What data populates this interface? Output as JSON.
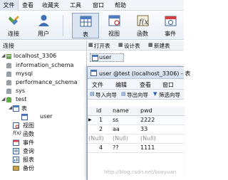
{
  "menubar": [
    "文件",
    "查看",
    "收藏夹",
    "工具",
    "窗口",
    "帮助"
  ],
  "toolbar": {
    "connect": "连接",
    "user": "用户",
    "table": "表",
    "view": "视图",
    "function": "函数",
    "event": "事件"
  },
  "connections_label": "连接",
  "tree": {
    "server": "localhost_3306",
    "dbs": [
      "information_schema",
      "mysql",
      "performance_schema",
      "sys",
      "test"
    ],
    "test_children": {
      "tables": "表",
      "table_user": "user",
      "views": "视图",
      "functions": "函数",
      "events": "事件",
      "queries": "查询",
      "reports": "报表",
      "backup": "备份"
    }
  },
  "obj_toolbar": {
    "open": "打开表",
    "design": "设计表",
    "new": "新建表"
  },
  "obj_item": "user",
  "table_window": {
    "title": "user @test (localhost_3306) - 表",
    "menu": [
      "文件",
      "编辑",
      "查看",
      "窗口"
    ],
    "tools": [
      "导入向导",
      "导出向导",
      "筛选向导"
    ],
    "columns": [
      "id",
      "name",
      "pwd"
    ],
    "rows": [
      [
        "1",
        "ss",
        "2222"
      ],
      [
        "2",
        "aa",
        "33"
      ],
      [
        "(Null)",
        "(Null)",
        "(Null)"
      ],
      [
        "4",
        "??",
        "1111"
      ]
    ]
  },
  "watermark": "http://blog.csdn.net/boxyuan",
  "colors": {
    "selected_tab": "#dbe5f1",
    "accent": "#2a5caa"
  }
}
